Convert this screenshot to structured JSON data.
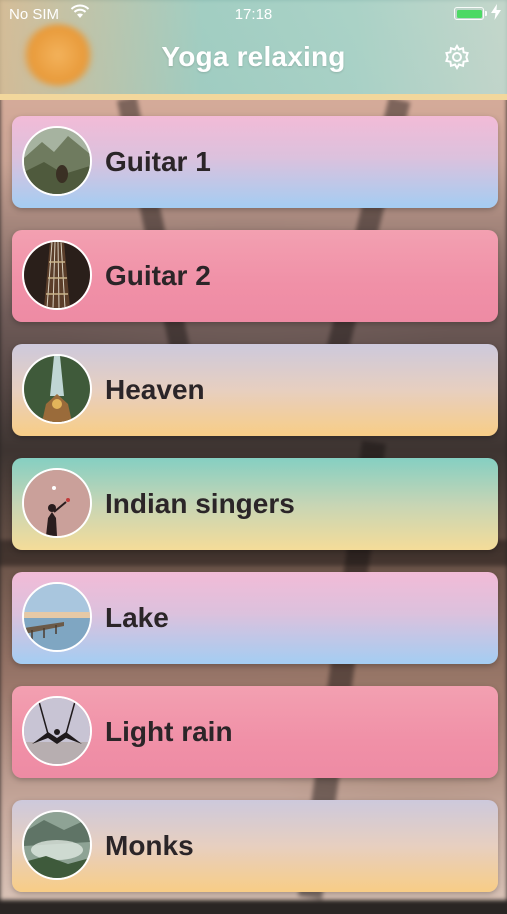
{
  "status_bar": {
    "carrier": "No SIM",
    "time": "17:18",
    "battery_level": 1.0,
    "charging_icon": "lightning-bolt-icon"
  },
  "nav": {
    "title": "Yoga relaxing",
    "settings_icon": "gear-icon"
  },
  "tracks": [
    {
      "label": "Guitar 1",
      "thumb": "rocky-landscape",
      "style": "blue"
    },
    {
      "label": "Guitar 2",
      "thumb": "guitar-strings",
      "style": "pink"
    },
    {
      "label": "Heaven",
      "thumb": "light-beam-church",
      "style": "peach"
    },
    {
      "label": "Indian singers",
      "thumb": "silhouette-sunset",
      "style": "teal"
    },
    {
      "label": "Lake",
      "thumb": "lake-pier",
      "style": "blue"
    },
    {
      "label": "Light rain",
      "thumb": "aerial-yoga",
      "style": "pink"
    },
    {
      "label": "Monks",
      "thumb": "misty-valley",
      "style": "peach"
    }
  ]
}
